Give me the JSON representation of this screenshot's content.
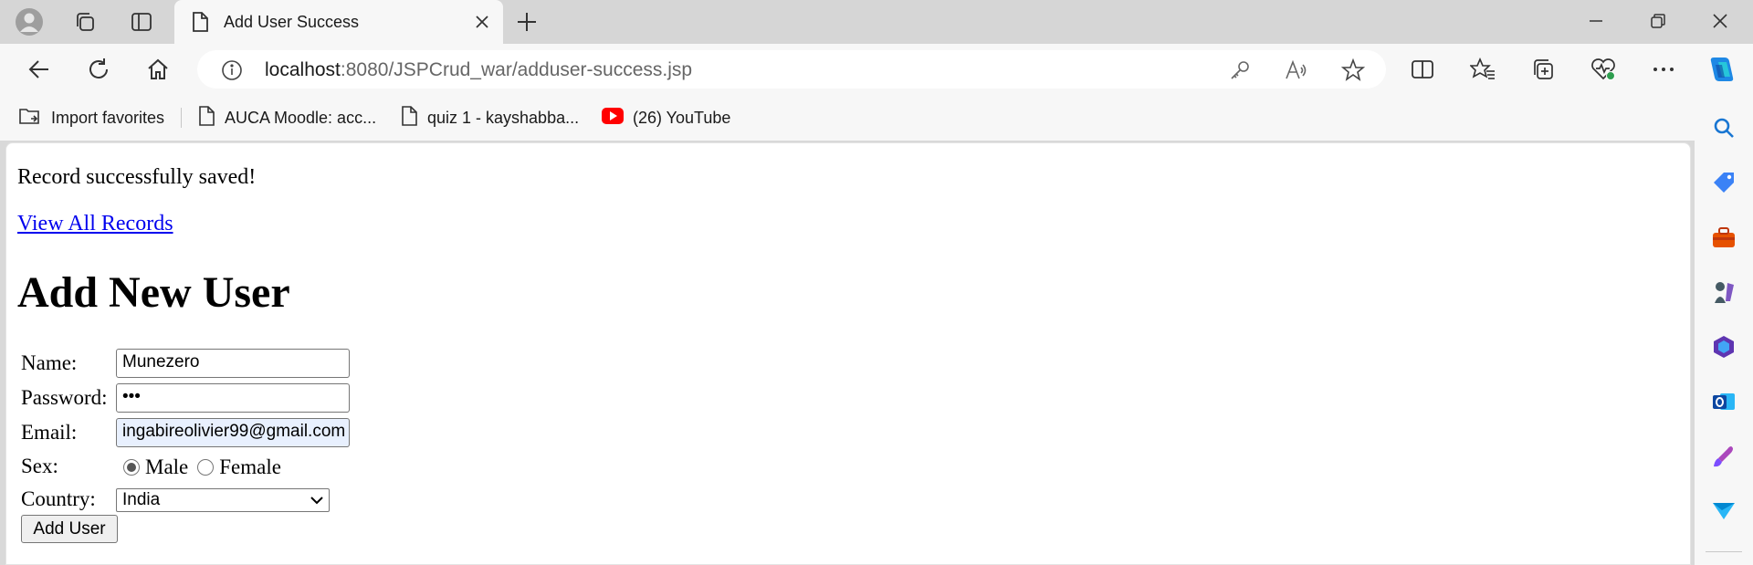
{
  "browser": {
    "tab": {
      "title": "Add User Success"
    },
    "address": {
      "host": "localhost",
      "path": ":8080/JSPCrud_war/adduser-success.jsp"
    },
    "bookmarks": [
      {
        "label": "Import favorites",
        "icon": "import-favorites-icon"
      },
      {
        "label": "AUCA Moodle: acc...",
        "icon": "page-icon"
      },
      {
        "label": "quiz 1 - kayshabba...",
        "icon": "page-icon"
      },
      {
        "label": "(26) YouTube",
        "icon": "youtube-icon"
      }
    ],
    "colors": {
      "chrome": "#d6d6d6",
      "toolbar": "#f7f7f7",
      "link": "#0000ee",
      "youtube": "#ff0000"
    }
  },
  "page": {
    "message": "Record successfully saved!",
    "link_label": "View All Records",
    "heading": "Add New User",
    "form": {
      "name_label": "Name:",
      "name_value": "Munezero",
      "password_label": "Password:",
      "password_value": "•••",
      "email_label": "Email:",
      "email_value": "ingabireolivier99@gmail.com",
      "sex_label": "Sex:",
      "sex_options": [
        "Male",
        "Female"
      ],
      "sex_selected": "Male",
      "country_label": "Country:",
      "country_value": "India",
      "submit_label": "Add User"
    }
  }
}
